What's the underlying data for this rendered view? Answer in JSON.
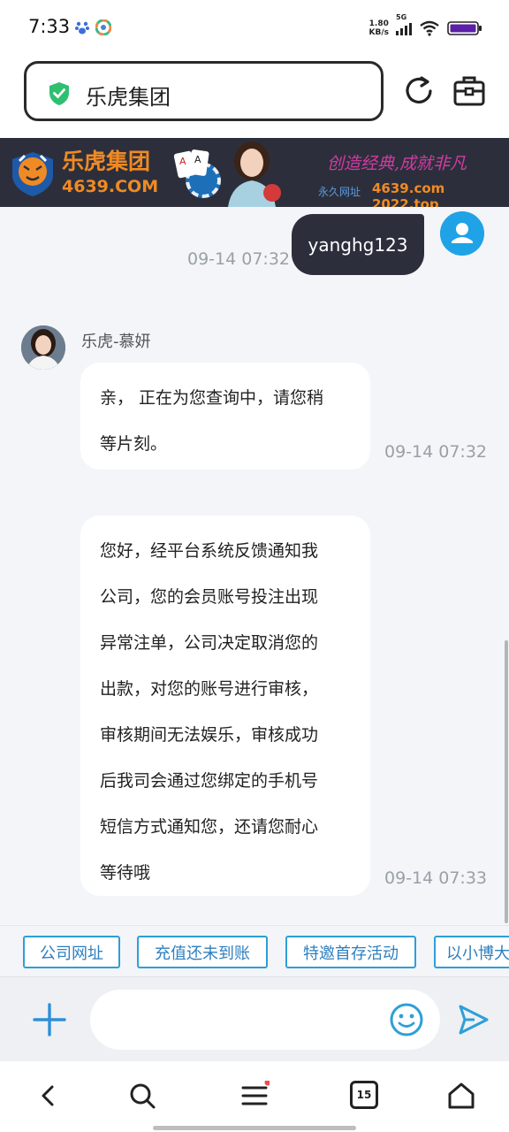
{
  "status_bar": {
    "time": "7:33",
    "net_speed_value": "1.80",
    "net_speed_unit": "KB/s",
    "network_type": "5G"
  },
  "address_bar": {
    "title": "乐虎集团"
  },
  "banner": {
    "brand_name": "乐虎集团",
    "domain": "4639.COM",
    "slogan": "创造经典,成就非凡",
    "site_label": "永久网址",
    "site_value": "4639.com 2022.top"
  },
  "chat": {
    "user_message": "yanghg123",
    "user_message_time": "09-14 07:32",
    "agent_name": "乐虎-慕妍",
    "messages": [
      {
        "lines": [
          "亲， 正在为您查询中，请您稍",
          "等片刻。"
        ],
        "time": "09-14 07:32"
      },
      {
        "lines": [
          "您好，经平台系统反馈通知我",
          "公司，您的会员账号投注出现",
          "异常注单，公司决定取消您的",
          "出款，对您的账号进行审核，",
          "审核期间无法娱乐，审核成功",
          "后我司会通过您绑定的手机号",
          "短信方式通知您，还请您耐心",
          "等待哦"
        ],
        "time": "09-14 07:33"
      }
    ]
  },
  "quick_replies": [
    "公司网址",
    "充值还未到账",
    "特邀首存活动",
    "以小博大"
  ],
  "input": {
    "placeholder": "",
    "value": ""
  },
  "bottom_nav": {
    "tab_count": "15"
  },
  "colors": {
    "brand_orange": "#f08a24",
    "dark_bubble": "#2c2f3b",
    "accent_blue": "#2e9fd8",
    "chat_bg": "#f3f5f8"
  },
  "icons": {
    "plus": "plus-icon",
    "emoji": "emoji-icon",
    "send": "send-icon",
    "back": "back-icon",
    "search": "search-icon",
    "menu": "menu-icon",
    "tabs": "tabs-icon",
    "home": "home-icon"
  }
}
